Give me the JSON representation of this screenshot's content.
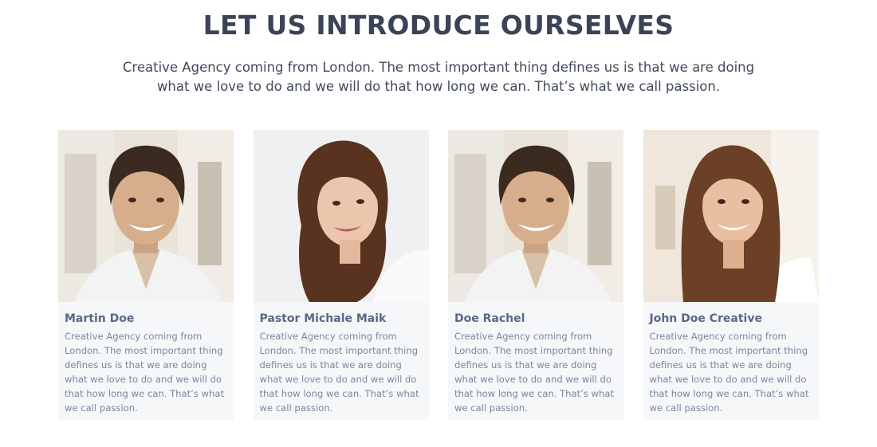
{
  "section": {
    "title": "LET US INTRODUCE OURSELVES",
    "intro": "Creative Agency coming from London. The most important thing defines us is that we are doing what we love to do and we will do that how long we can. That’s what we call passion."
  },
  "team": [
    {
      "name": "Martin Doe",
      "bio": "Creative Agency coming from London. The most important thing defines us is that we are doing what we love to do and we will do that how long we can. That’s what we call passion.",
      "photo_icon": "man-portrait"
    },
    {
      "name": "Pastor Michale Maik",
      "bio": "Creative Agency coming from London. The most important thing defines us is that we are doing what we love to do and we will do that how long we can. That’s what we call passion.",
      "photo_icon": "woman-portrait"
    },
    {
      "name": "Doe Rachel",
      "bio": "Creative Agency coming from London. The most important thing defines us is that we are doing what we love to do and we will do that how long we can. That’s what we call passion.",
      "photo_icon": "man-portrait"
    },
    {
      "name": "John Doe Creative",
      "bio": "Creative Agency coming from London. The most important thing defines us is that we are doing what we love to do and we will do that how long we can. That’s what we call passion.",
      "photo_icon": "woman-portrait"
    }
  ],
  "colors": {
    "title": "#3a4456",
    "name": "#5a6786",
    "bio": "#7a869e",
    "card_bg": "#f6f7f9"
  }
}
